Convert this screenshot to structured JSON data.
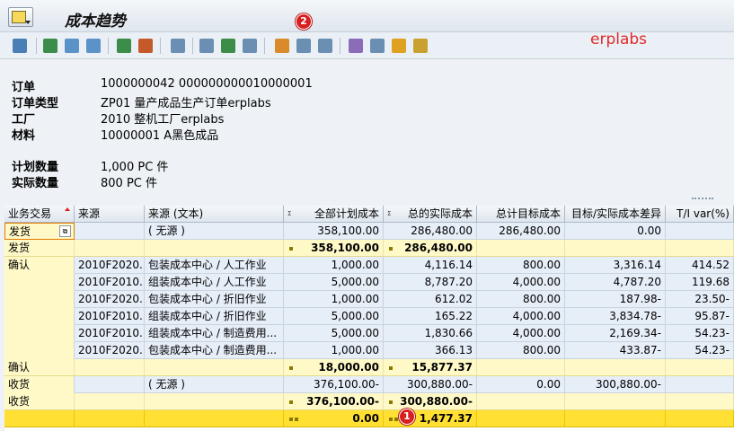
{
  "title": "成本趋势",
  "brand": "erplabs",
  "badges": {
    "top": "2",
    "bottom": "1"
  },
  "header": [
    {
      "label": "订单",
      "value": "1000000042 000000000010000001"
    },
    {
      "label": "订单类型",
      "value": "ZP01 量产成品生产订单erplabs"
    },
    {
      "label": "工厂",
      "value": "2010 整机工厂erplabs"
    },
    {
      "label": "材料",
      "value": "10000001 A黑色成品"
    },
    {
      "label": "计划数量",
      "value": "1,000 PC 件"
    },
    {
      "label": "实际数量",
      "value": "800 PC 件"
    }
  ],
  "columns": [
    "业务交易",
    "来源",
    "来源 (文本)",
    "全部计划成本",
    "总的实际成本",
    "总计目标成本",
    "目标/实际成本差异",
    "T/I var(%)"
  ],
  "sigma": "Σ",
  "rows": [
    {
      "kind": "data",
      "tx": "发货",
      "src": "",
      "srctext": "( 无源 )",
      "plan": "358,100.00",
      "actual": "286,480.00",
      "target": "286,480.00",
      "diff": "0.00",
      "var": ""
    },
    {
      "kind": "sub",
      "tx": "发货",
      "plan": "358,100.00",
      "actual": "286,480.00"
    },
    {
      "kind": "data",
      "tx": "确认",
      "src": "2010F2020...",
      "srctext": "包装成本中心 / 人工作业",
      "plan": "1,000.00",
      "actual": "4,116.14",
      "target": "800.00",
      "diff": "3,316.14",
      "var": "414.52"
    },
    {
      "kind": "data",
      "tx": "",
      "src": "2010F2010...",
      "srctext": "组装成本中心 / 人工作业",
      "plan": "5,000.00",
      "actual": "8,787.20",
      "target": "4,000.00",
      "diff": "4,787.20",
      "var": "119.68"
    },
    {
      "kind": "data",
      "tx": "",
      "src": "2010F2020...",
      "srctext": "包装成本中心 / 折旧作业",
      "plan": "1,000.00",
      "actual": "612.02",
      "target": "800.00",
      "diff": "187.98-",
      "var": "23.50-"
    },
    {
      "kind": "data",
      "tx": "",
      "src": "2010F2010...",
      "srctext": "组装成本中心 / 折旧作业",
      "plan": "5,000.00",
      "actual": "165.22",
      "target": "4,000.00",
      "diff": "3,834.78-",
      "var": "95.87-"
    },
    {
      "kind": "data",
      "tx": "",
      "src": "2010F2010...",
      "srctext": "组装成本中心 / 制造费用...",
      "plan": "5,000.00",
      "actual": "1,830.66",
      "target": "4,000.00",
      "diff": "2,169.34-",
      "var": "54.23-"
    },
    {
      "kind": "data",
      "tx": "",
      "src": "2010F2020...",
      "srctext": "包装成本中心 / 制造费用...",
      "plan": "1,000.00",
      "actual": "366.13",
      "target": "800.00",
      "diff": "433.87-",
      "var": "54.23-"
    },
    {
      "kind": "sub",
      "tx": "确认",
      "plan": "18,000.00",
      "actual": "15,877.37"
    },
    {
      "kind": "data",
      "tx": "收货",
      "src": "",
      "srctext": "( 无源 )",
      "plan": "376,100.00-",
      "actual": "300,880.00-",
      "target": "0.00",
      "diff": "300,880.00-",
      "var": ""
    },
    {
      "kind": "sub",
      "tx": "收货",
      "plan": "376,100.00-",
      "actual": "300,880.00-"
    },
    {
      "kind": "total",
      "tx": "",
      "plan": "0.00",
      "actual": "1,477.37"
    }
  ]
}
